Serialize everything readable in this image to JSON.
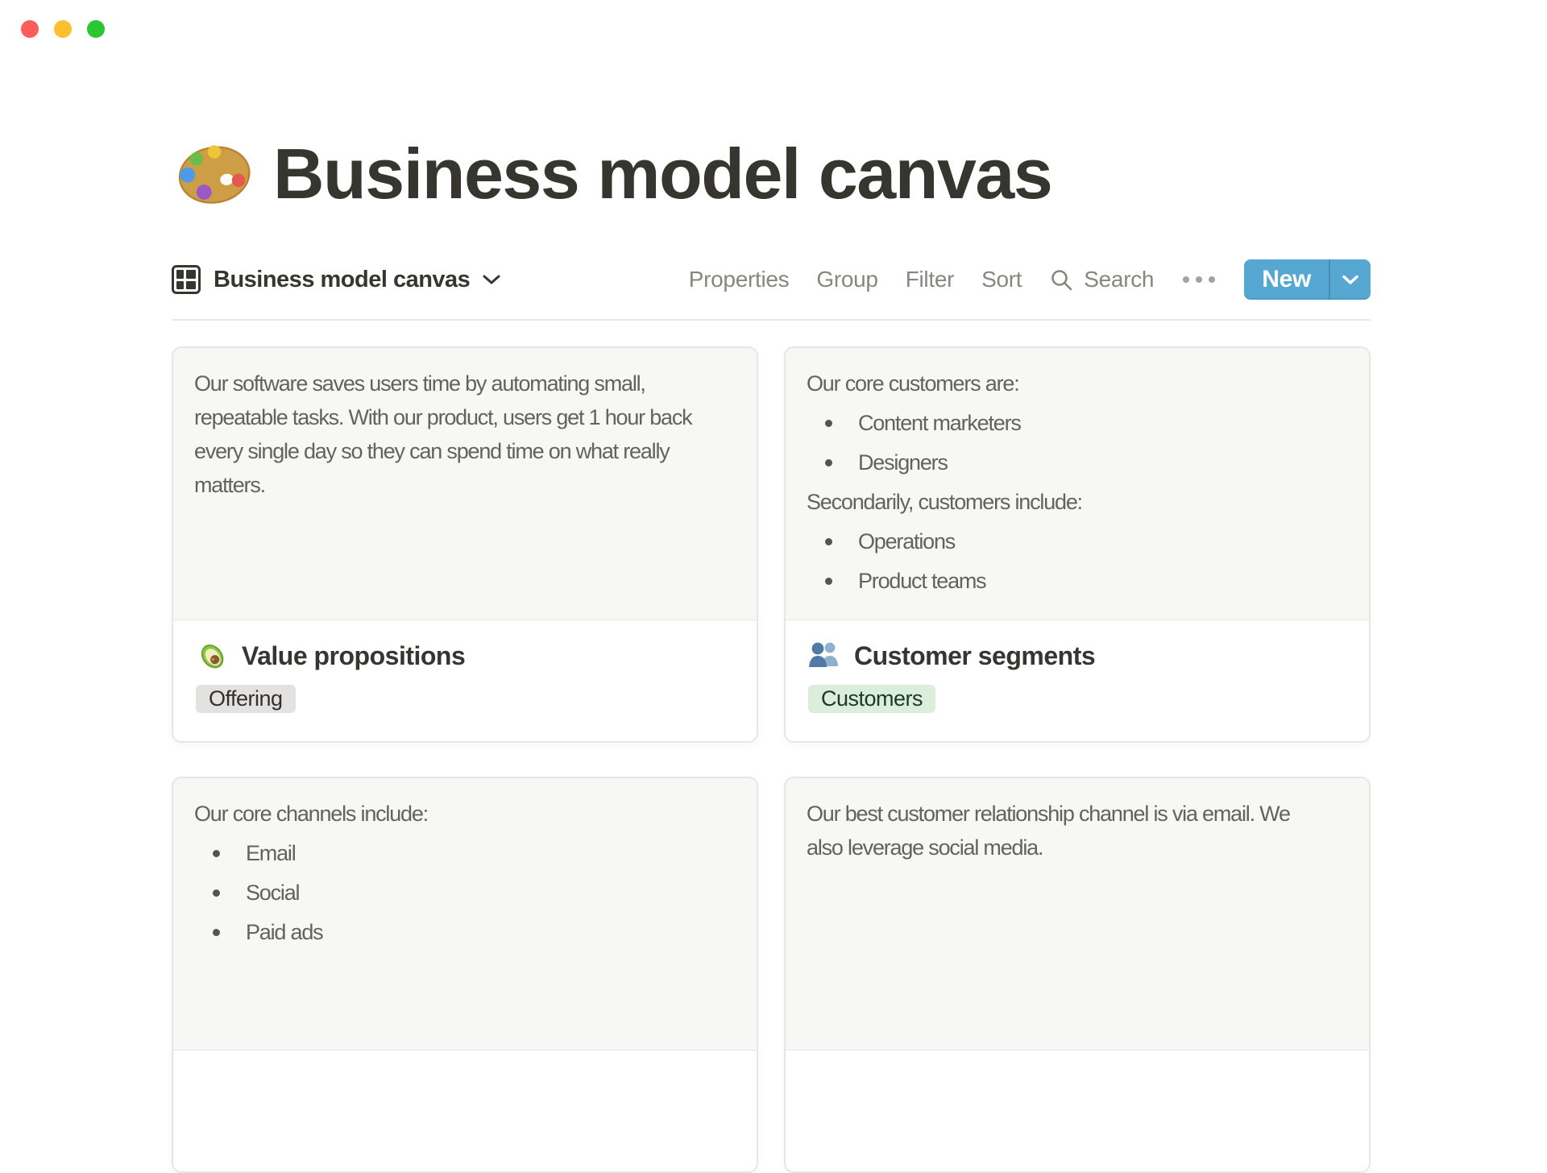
{
  "window": {
    "controls": {
      "close": "close",
      "minimize": "minimize",
      "zoom": "zoom"
    }
  },
  "page": {
    "icon": "palette",
    "title": "Business model canvas"
  },
  "view_bar": {
    "view_icon": "gallery-grid",
    "view_name": "Business model canvas",
    "properties_label": "Properties",
    "group_label": "Group",
    "filter_label": "Filter",
    "sort_label": "Sort",
    "search_label": "Search",
    "more_icon": "ellipsis",
    "new_label": "New"
  },
  "colors": {
    "accent_blue": "#57A7D3",
    "text_dark": "#37352F",
    "text_gray": "#63625B",
    "toolbar_gray": "#87867F",
    "preview_bg": "#F7F7F5",
    "tag_gray_bg": "#E3E2E0",
    "tag_green_bg": "#DBEDDB",
    "traffic_red": "#FC5F57",
    "traffic_yellow": "#FDBE2F",
    "traffic_green": "#29C732"
  },
  "cards": [
    {
      "icon": "avocado",
      "title": "Value propositions",
      "tag": "Offering",
      "tag_color": "gray",
      "preview_text": "Our software saves users time by automating small,\nrepeatable tasks. With our product, users get 1 hour back\nevery single day so they can spend time on what really\nmatters."
    },
    {
      "icon": "busts-in-silhouette",
      "title": "Customer segments",
      "tag": "Customers",
      "tag_color": "green",
      "blocks": [
        {
          "type": "p",
          "text": "Our core customers are:"
        },
        {
          "type": "li",
          "text": "Content marketers"
        },
        {
          "type": "li",
          "text": "Designers"
        },
        {
          "type": "p",
          "text": "Secondarily, customers include:"
        },
        {
          "type": "li",
          "text": "Operations"
        },
        {
          "type": "li",
          "text": "Product teams"
        }
      ]
    },
    {
      "blocks": [
        {
          "type": "p",
          "text": "Our core channels include:"
        },
        {
          "type": "li",
          "text": "Email"
        },
        {
          "type": "li",
          "text": "Social"
        },
        {
          "type": "li",
          "text": "Paid ads"
        }
      ]
    },
    {
      "preview_text": "Our best customer relationship channel is via email. We\nalso leverage social media."
    }
  ]
}
